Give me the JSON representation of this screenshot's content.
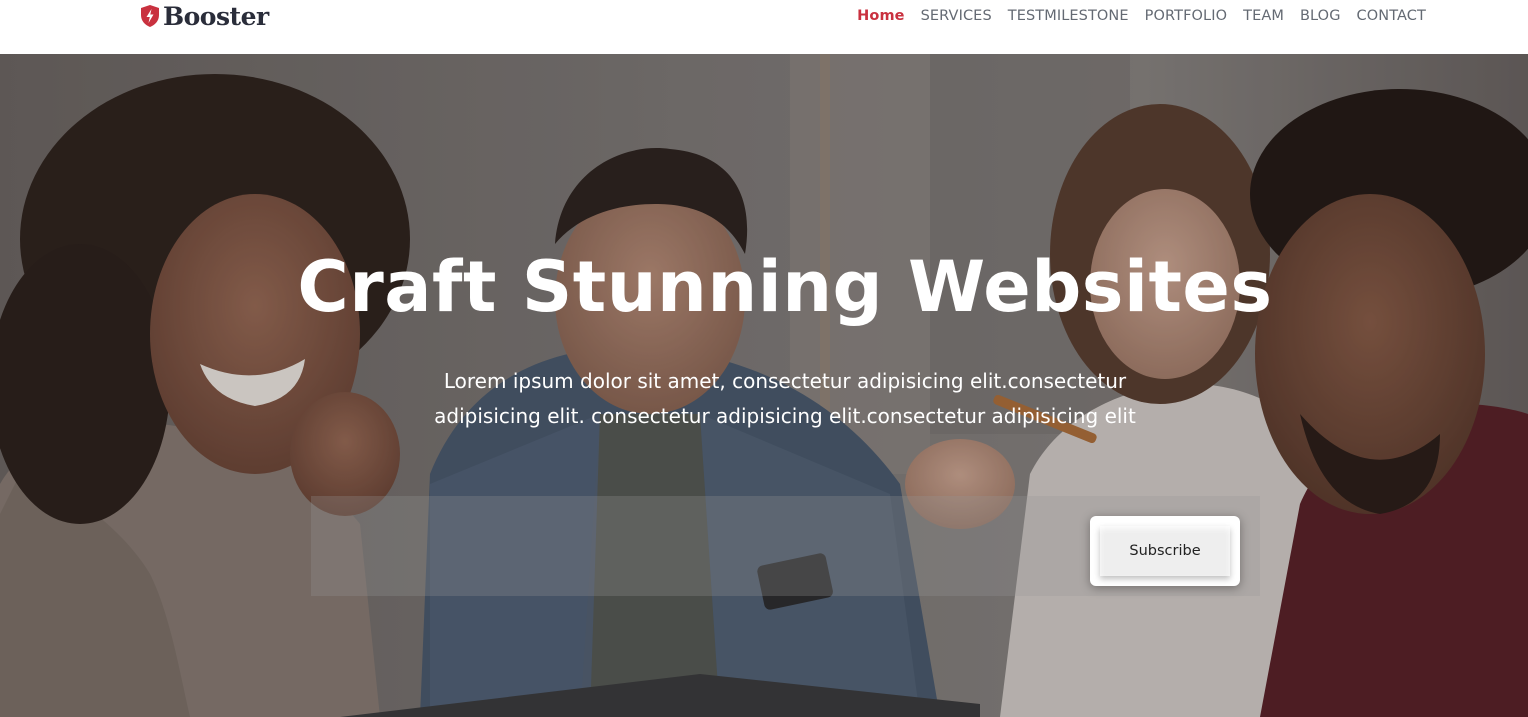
{
  "brand": {
    "name": "Booster",
    "logo_icon": "shield-bolt-icon",
    "logo_color": "#c9313f"
  },
  "nav": {
    "items": [
      {
        "label": "Home",
        "active": true
      },
      {
        "label": "SERVICES",
        "active": false
      },
      {
        "label": "TESTMILESTONE",
        "active": false
      },
      {
        "label": "PORTFOLIO",
        "active": false
      },
      {
        "label": "TEAM",
        "active": false
      },
      {
        "label": "BLOG",
        "active": false
      },
      {
        "label": "CONTACT",
        "active": false
      }
    ],
    "active_color": "#c9313f",
    "text_color": "#646a73"
  },
  "hero": {
    "title": "Craft Stunning Websites",
    "text": "Lorem ipsum dolor sit amet, consectetur adipisicing elit.consectetur adipisicing elit. consectetur adipisicing elit.consectetur adipisicing elit",
    "subscribe": {
      "email_value": "",
      "button_label": "Subscribe"
    }
  }
}
